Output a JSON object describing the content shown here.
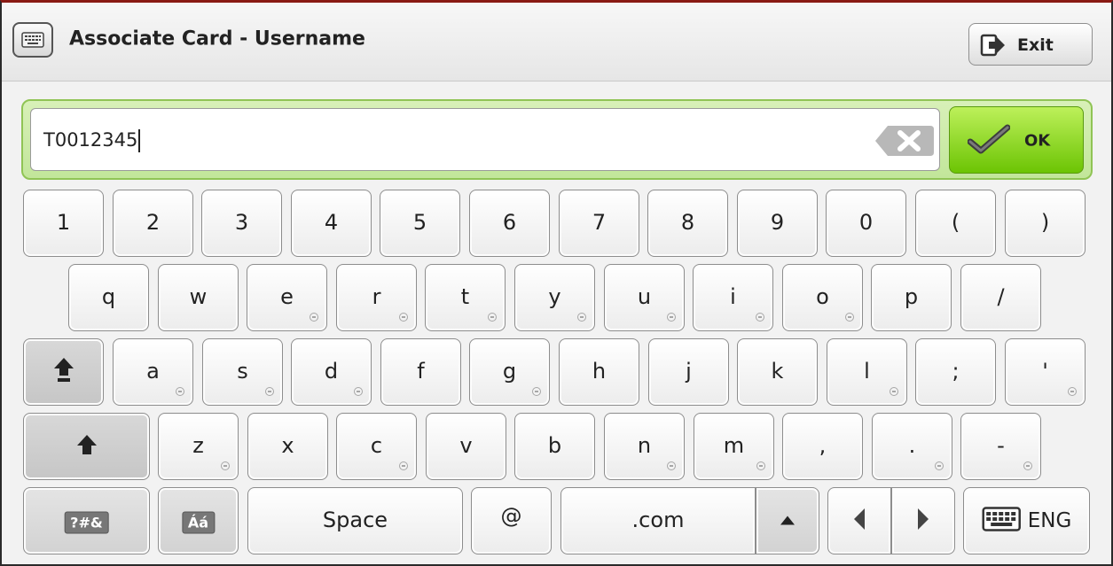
{
  "title": "Associate Card - Username",
  "exit_label": "Exit",
  "input": {
    "value": "T0012345"
  },
  "ok_label": "OK",
  "rows": [
    {
      "keys": [
        {
          "label": "1"
        },
        {
          "label": "2"
        },
        {
          "label": "3"
        },
        {
          "label": "4"
        },
        {
          "label": "5"
        },
        {
          "label": "6"
        },
        {
          "label": "7"
        },
        {
          "label": "8"
        },
        {
          "label": "9"
        },
        {
          "label": "0"
        },
        {
          "label": "("
        },
        {
          "label": ")"
        }
      ]
    },
    {
      "keys": [
        {
          "label": "q"
        },
        {
          "label": "w"
        },
        {
          "label": "e",
          "accent": true
        },
        {
          "label": "r",
          "accent": true
        },
        {
          "label": "t",
          "accent": true
        },
        {
          "label": "y",
          "accent": true
        },
        {
          "label": "u",
          "accent": true
        },
        {
          "label": "i",
          "accent": true
        },
        {
          "label": "o",
          "accent": true
        },
        {
          "label": "p"
        },
        {
          "label": "/"
        }
      ]
    },
    {
      "keys": [
        {
          "label": "a",
          "accent": true
        },
        {
          "label": "s",
          "accent": true
        },
        {
          "label": "d",
          "accent": true
        },
        {
          "label": "f"
        },
        {
          "label": "g",
          "accent": true
        },
        {
          "label": "h"
        },
        {
          "label": "j"
        },
        {
          "label": "k"
        },
        {
          "label": "l",
          "accent": true
        },
        {
          "label": ";"
        },
        {
          "label": "'",
          "accent": true
        }
      ]
    },
    {
      "keys": [
        {
          "label": "z",
          "accent": true
        },
        {
          "label": "x"
        },
        {
          "label": "c",
          "accent": true
        },
        {
          "label": "v"
        },
        {
          "label": "b"
        },
        {
          "label": "n",
          "accent": true
        },
        {
          "label": "m",
          "accent": true
        },
        {
          "label": ","
        },
        {
          "label": ".",
          "accent": true
        },
        {
          "label": "-",
          "accent": true
        }
      ]
    }
  ],
  "bottom": {
    "symbols_label": "?#&",
    "accents_label": "Áá",
    "space_label": "Space",
    "at_label": "@",
    "com_label": ".com",
    "language_label": "ENG"
  },
  "icons": {
    "title": "keyboard-icon",
    "exit": "exit-icon",
    "backspace": "backspace-icon",
    "ok": "checkmark-icon",
    "caps_lock": "caps-lock-icon",
    "shift": "shift-icon",
    "up": "up-arrow-icon",
    "left": "left-arrow-icon",
    "right": "right-arrow-icon",
    "language": "keyboard-icon"
  },
  "colors": {
    "ok_green": "#7ed31c",
    "input_border": "#90c455",
    "top_border": "#8a1a14"
  }
}
